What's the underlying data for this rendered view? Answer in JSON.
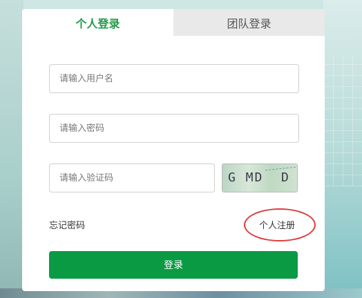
{
  "tabs": [
    {
      "label": "个人登录",
      "active": true
    },
    {
      "label": "团队登录",
      "active": false
    }
  ],
  "form": {
    "username": {
      "placeholder": "请输入用户名",
      "value": ""
    },
    "password": {
      "placeholder": "请输入密码",
      "value": ""
    },
    "captcha": {
      "placeholder": "请输入验证码",
      "value": "",
      "image_text": "G MD  D G"
    }
  },
  "links": {
    "forgot_password": "忘记密码",
    "register": "个人注册"
  },
  "login_button": "登录",
  "colors": {
    "accent": "#1f9a45",
    "button": "#0a9a44",
    "annotation_circle": "#e03a3a"
  }
}
